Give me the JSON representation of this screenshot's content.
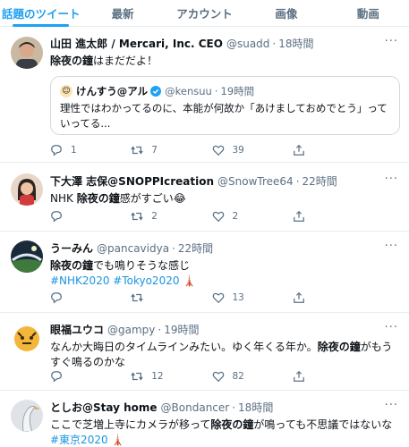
{
  "tabs": [
    "話題のツイート",
    "最新",
    "アカウント",
    "画像",
    "動画"
  ],
  "more_icon": "more-icon",
  "tweets": [
    {
      "name": "山田 進太郎 / Mercari, Inc. CEO",
      "handle": "@suadd",
      "time": "18時間",
      "text": [
        {
          "b": "除夜の鐘"
        },
        {
          "t": "はまだだよ！"
        }
      ],
      "quote": {
        "name": "けんすう@アル",
        "handle": "@kensuu",
        "time": "19時間",
        "text": "理性ではわかってるのに、本能が何故か「あけましておめでとう」っていってる..."
      },
      "reply": "1",
      "retweet": "7",
      "like": "39"
    },
    {
      "name": "下大澤 志保@SNOPPIcreation",
      "handle": "@SnowTree64",
      "time": "22時間",
      "text": [
        {
          "t": "NHK "
        },
        {
          "b": "除夜の鐘"
        },
        {
          "t": "感がすごい😂"
        }
      ],
      "reply": "",
      "retweet": "2",
      "like": "2"
    },
    {
      "name": "うーみん",
      "handle": "@pancavidya",
      "time": "22時間",
      "text": [
        {
          "b": "除夜の鐘"
        },
        {
          "t": "でも鳴りそうな感じ"
        }
      ],
      "tags": "#NHK2020 #Tokyo2020 🗼",
      "reply": "",
      "retweet": "",
      "like": "13"
    },
    {
      "name": "眼福ユウコ",
      "handle": "@gampy",
      "time": "19時間",
      "text": [
        {
          "t": "なんか大晦日のタイムラインみたい。ゆく年くる年か。"
        },
        {
          "b": "除夜の鐘"
        },
        {
          "t": "がもうすぐ鳴るのかな"
        }
      ],
      "reply": "",
      "retweet": "12",
      "like": "82"
    },
    {
      "name": "としお@Stay home",
      "handle": "@Bondancer",
      "time": "18時間",
      "text": [
        {
          "t": "ここで芝増上寺にカメラが移って"
        },
        {
          "b": "除夜の鐘"
        },
        {
          "t": "が鳴っても不思議ではないな"
        }
      ],
      "tags": "#東京2020 🗼"
    }
  ],
  "colors": {
    "accent": "#1da1f2",
    "muted": "#5b7083",
    "border": "#e6ecf0",
    "link": "#1b95e0"
  }
}
